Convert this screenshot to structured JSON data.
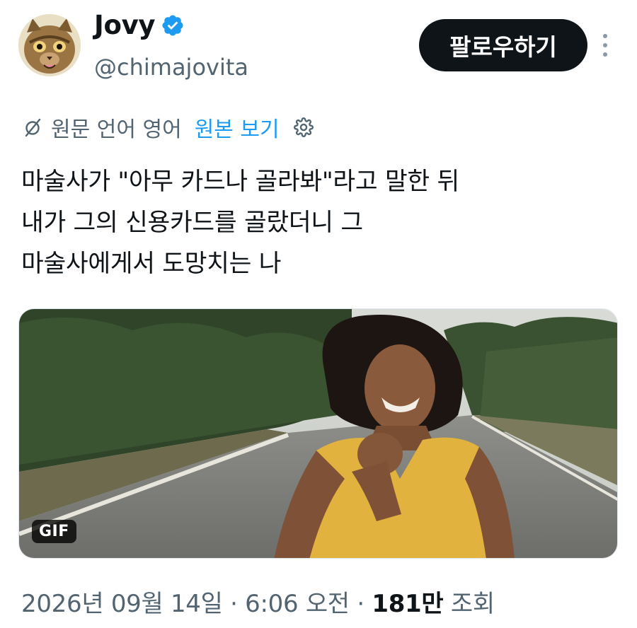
{
  "author": {
    "name": "Jovy",
    "handle": "@chimajovita",
    "verified_color": "#1d9bf0"
  },
  "follow_label": "팔로우하기",
  "translation": {
    "notice": "원문 언어 영어",
    "show_original": "원본 보기"
  },
  "tweet_text": {
    "line1": "마술사가 \"아무 카드나 골라봐\"라고 말한 뒤",
    "line2": "내가 그의 신용카드를 골랐더니 그",
    "line3": "마술사에게서 도망치는 나"
  },
  "media": {
    "badge": "GIF"
  },
  "meta": {
    "date": "2026년 09월 14일",
    "sep1": "·",
    "time": "6:06 오전",
    "sep2": "·",
    "views_count": "181만",
    "views_label": "조회"
  },
  "icons": {
    "translate": "translate-slash-icon",
    "settings": "gear-icon",
    "more": "more-vertical-icon",
    "verified": "verified-badge-icon"
  },
  "colors": {
    "accent": "#1d9bf0",
    "text": "#0f1419",
    "muted": "#536471",
    "follow_bg": "#0f1419"
  }
}
